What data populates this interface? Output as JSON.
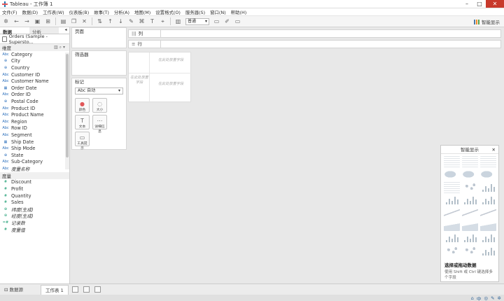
{
  "window": {
    "title": "Tableau - 工作簿 1"
  },
  "menu": [
    "文件(F)",
    "数据(D)",
    "工作表(W)",
    "仪表板(B)",
    "故事(T)",
    "分析(A)",
    "地图(M)",
    "设置格式(O)",
    "服务器(S)",
    "窗口(N)",
    "帮助(H)"
  ],
  "toolbar": {
    "fit_select": "普通",
    "smart_show_label": "智能显示"
  },
  "left_pane": {
    "tabs": [
      "数据",
      "分析"
    ],
    "datasource": "Orders (Sample - Supersto...",
    "dimensions_header": "维度",
    "dimensions": [
      {
        "icon": "Abc",
        "name": "Category"
      },
      {
        "icon": "⊕",
        "name": "City"
      },
      {
        "icon": "⊕",
        "name": "Country"
      },
      {
        "icon": "Abc",
        "name": "Customer ID"
      },
      {
        "icon": "Abc",
        "name": "Customer Name"
      },
      {
        "icon": "▦",
        "name": "Order Date"
      },
      {
        "icon": "Abc",
        "name": "Order ID"
      },
      {
        "icon": "⊕",
        "name": "Postal Code"
      },
      {
        "icon": "Abc",
        "name": "Product ID"
      },
      {
        "icon": "Abc",
        "name": "Product Name"
      },
      {
        "icon": "Abc",
        "name": "Region"
      },
      {
        "icon": "Abc",
        "name": "Row ID"
      },
      {
        "icon": "Abc",
        "name": "Segment"
      },
      {
        "icon": "▦",
        "name": "Ship Date"
      },
      {
        "icon": "Abc",
        "name": "Ship Mode"
      },
      {
        "icon": "⊕",
        "name": "State"
      },
      {
        "icon": "Abc",
        "name": "Sub-Category"
      },
      {
        "icon": "Abc",
        "name": "度量名称"
      }
    ],
    "measures_header": "度量",
    "measures": [
      {
        "icon": "#",
        "name": "Discount"
      },
      {
        "icon": "#",
        "name": "Profit"
      },
      {
        "icon": "#",
        "name": "Quantity"
      },
      {
        "icon": "#",
        "name": "Sales"
      },
      {
        "icon": "⊕",
        "name": "纬度(生成)"
      },
      {
        "icon": "⊕",
        "name": "经度(生成)"
      },
      {
        "icon": "=#",
        "name": "记录数"
      },
      {
        "icon": "#",
        "name": "度量值"
      }
    ]
  },
  "cards": {
    "pages": "页面",
    "filters": "筛选器",
    "marks": "标记",
    "marks_type": "Abc 自动",
    "mark_buttons": [
      "颜色",
      "大小",
      "文本",
      "详细信息",
      "工具提示"
    ]
  },
  "shelves": {
    "columns": "列",
    "rows": "行"
  },
  "canvas_hints": {
    "top": "在此处放置字段",
    "left": "在此处放置字段",
    "body": "在此处放置字段"
  },
  "show_me": {
    "title": "智能显示",
    "prompt": "选择或拖动数据",
    "description": "使用 Shift 或 Ctrl 键选择多个字段"
  },
  "bottom": {
    "datasource_tab": "数据源",
    "sheet_tab": "工作表 1"
  }
}
